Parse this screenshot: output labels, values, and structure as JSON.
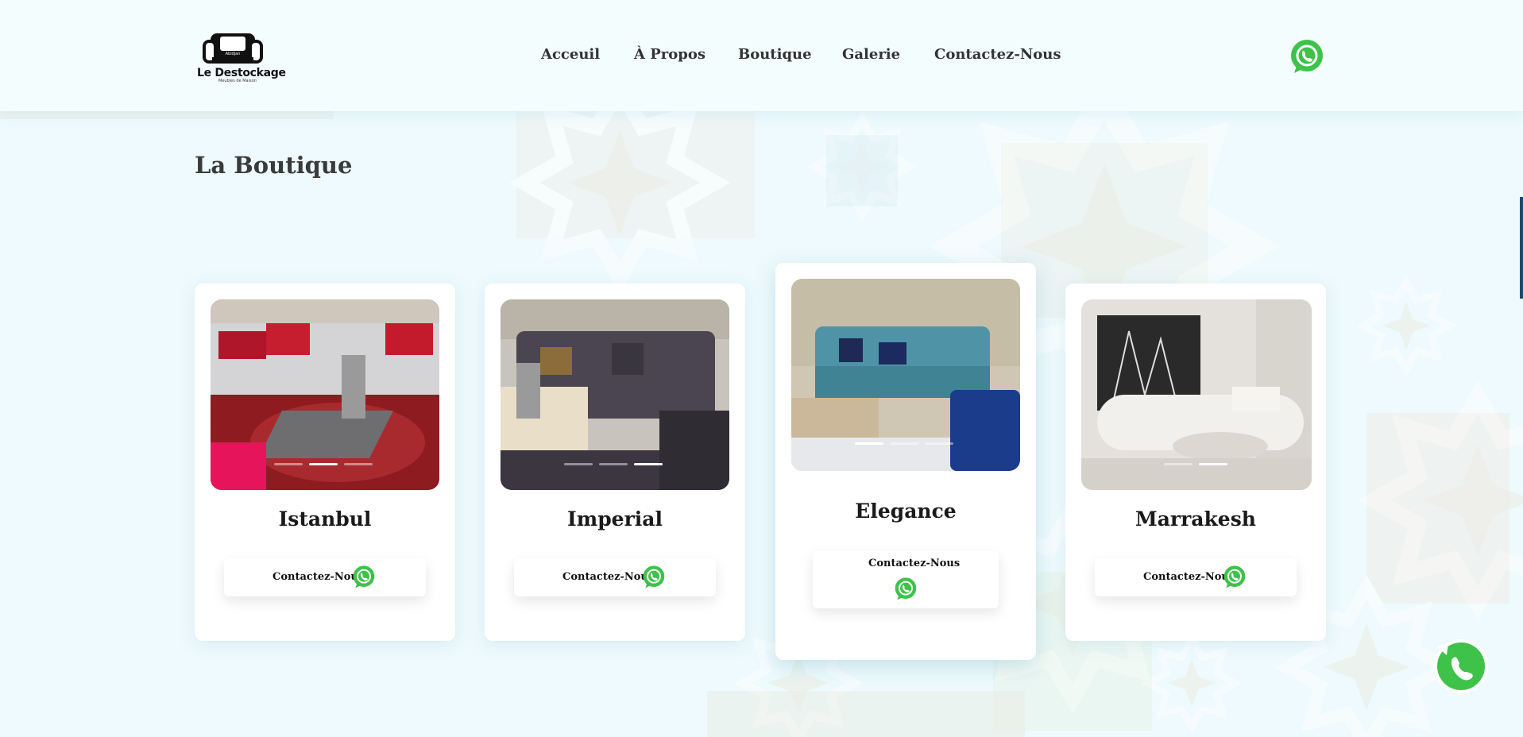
{
  "brand": {
    "logo_top": "Abidjan",
    "name": "Le Destockage",
    "tagline": "Meubles de Maison"
  },
  "nav": {
    "items": [
      {
        "label": "Acceuil"
      },
      {
        "label": "À Propos"
      },
      {
        "label": "Boutique"
      },
      {
        "label": "Galerie"
      },
      {
        "label": "Contactez-Nous"
      }
    ]
  },
  "header": {
    "whatsapp_icon": "whatsapp-icon"
  },
  "page": {
    "title": "La Boutique"
  },
  "products": [
    {
      "name": "Istanbul",
      "button_label": "Contactez-Nous",
      "slides": 3,
      "active_slide": 2
    },
    {
      "name": "Imperial",
      "button_label": "Contactez-Nous",
      "slides": 3,
      "active_slide": 3
    },
    {
      "name": "Elegance",
      "button_label": "Contactez-Nous",
      "slides": 3,
      "active_slide": 1
    },
    {
      "name": "Marrakesh",
      "button_label": "Contactez-Nous",
      "slides": 2,
      "active_slide": 2
    }
  ],
  "floating": {
    "icon": "phone-icon"
  },
  "colors": {
    "background": "#eefafd",
    "whatsapp_green": "#3ec24a",
    "text_dark": "#333333"
  }
}
